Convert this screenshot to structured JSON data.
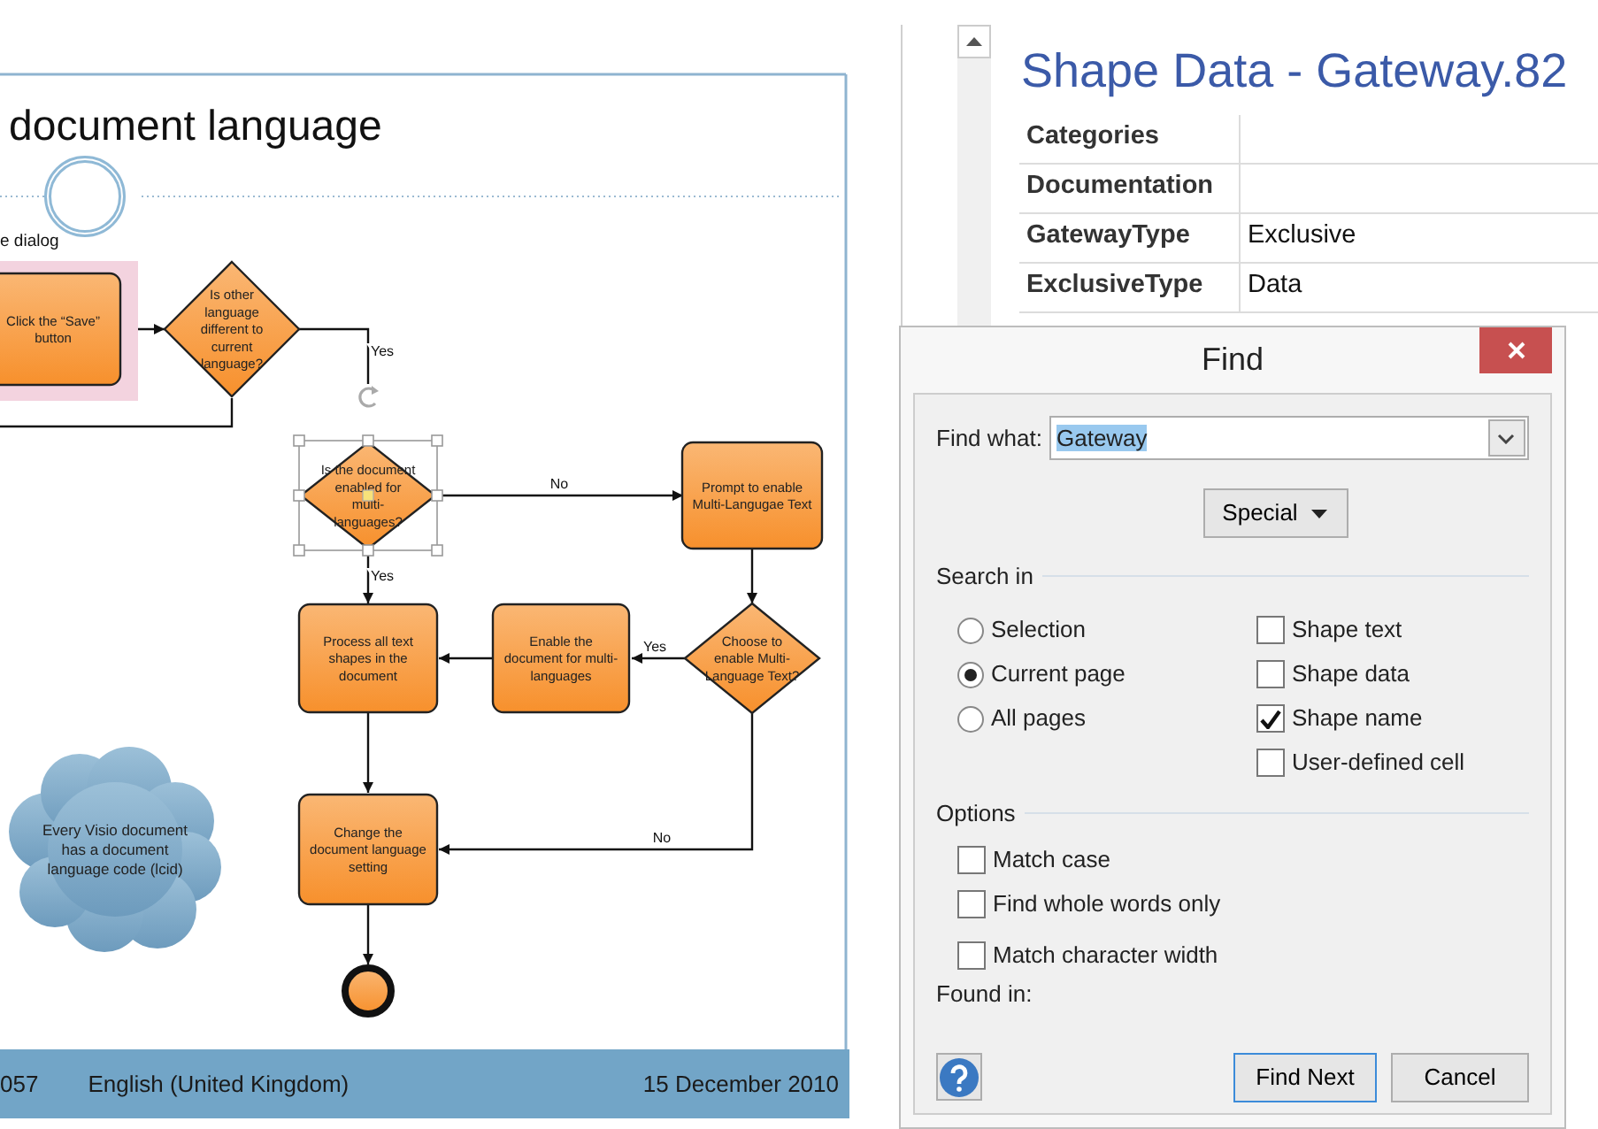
{
  "diagram": {
    "title": "document language",
    "lane_label": "e dialog",
    "nodes": [
      {
        "kind": "start_event",
        "selected": false,
        "highlighted": false
      },
      {
        "kind": "task",
        "lines": [
          "Click the “Save”",
          "button"
        ],
        "selected": false,
        "highlighted": true
      },
      {
        "kind": "gateway",
        "lines": [
          "Is other",
          "language",
          "different to",
          "current",
          "language?"
        ],
        "selected": false,
        "highlighted": false
      },
      {
        "kind": "gateway",
        "lines": [
          "Is the document",
          "enabled for",
          "multi-",
          "languages?"
        ],
        "selected": true,
        "highlighted": false
      },
      {
        "kind": "task",
        "lines": [
          "Prompt to enable",
          "Multi-Langugae Text"
        ],
        "selected": false,
        "highlighted": false
      },
      {
        "kind": "task",
        "lines": [
          "Process all text",
          "shapes in the",
          "document"
        ],
        "selected": false,
        "highlighted": false
      },
      {
        "kind": "task",
        "lines": [
          "Enable the",
          "document for multi-",
          "languages"
        ],
        "selected": false,
        "highlighted": false
      },
      {
        "kind": "gateway",
        "lines": [
          "Choose to",
          "enable Multi-",
          "Language Text?"
        ],
        "selected": false,
        "highlighted": false
      },
      {
        "kind": "annotation",
        "lines": [
          "Every Visio document",
          "has a document",
          "language code (lcid)"
        ],
        "selected": false,
        "highlighted": false
      },
      {
        "kind": "task",
        "lines": [
          "Change the",
          "document language",
          "setting"
        ],
        "selected": false,
        "highlighted": false
      },
      {
        "kind": "end_event",
        "selected": false,
        "highlighted": false
      }
    ],
    "edge_labels": [
      "Yes",
      "No",
      "Yes",
      "Yes",
      "No"
    ]
  },
  "footer": {
    "code": "057",
    "language": "English (United Kingdom)",
    "date": "15 December 2010"
  },
  "shape_data": {
    "title": "Shape Data - Gateway.82",
    "rows": [
      {
        "label": "Categories"
      },
      {
        "label": "Documentation"
      },
      {
        "label": "GatewayType",
        "value": "Exclusive"
      },
      {
        "label": "ExclusiveType",
        "value": "Data"
      }
    ]
  },
  "find_dialog": {
    "title": "Find",
    "find_what_label": "Find what:",
    "find_what": "Gateway",
    "text_selected": true,
    "special_button": "Special",
    "search_in_heading": "Search in",
    "scopes": [
      {
        "label": "Selection",
        "selected": false
      },
      {
        "label": "Current page",
        "selected": true
      },
      {
        "label": "All pages",
        "selected": false
      }
    ],
    "search_fields": [
      {
        "label": "Shape text",
        "checked": false
      },
      {
        "label": "Shape data",
        "checked": false
      },
      {
        "label": "Shape name",
        "checked": true
      },
      {
        "label": "User-defined cell",
        "checked": false
      }
    ],
    "options_heading": "Options",
    "options": [
      {
        "label": "Match case",
        "checked": false
      },
      {
        "label": "Find whole words only",
        "checked": false
      },
      {
        "label": "Match character width",
        "checked": false
      }
    ],
    "found_in_label": "Found in:",
    "buttons": [
      {
        "label": "Find Next",
        "default": true
      },
      {
        "label": "Cancel",
        "default": false
      }
    ]
  }
}
